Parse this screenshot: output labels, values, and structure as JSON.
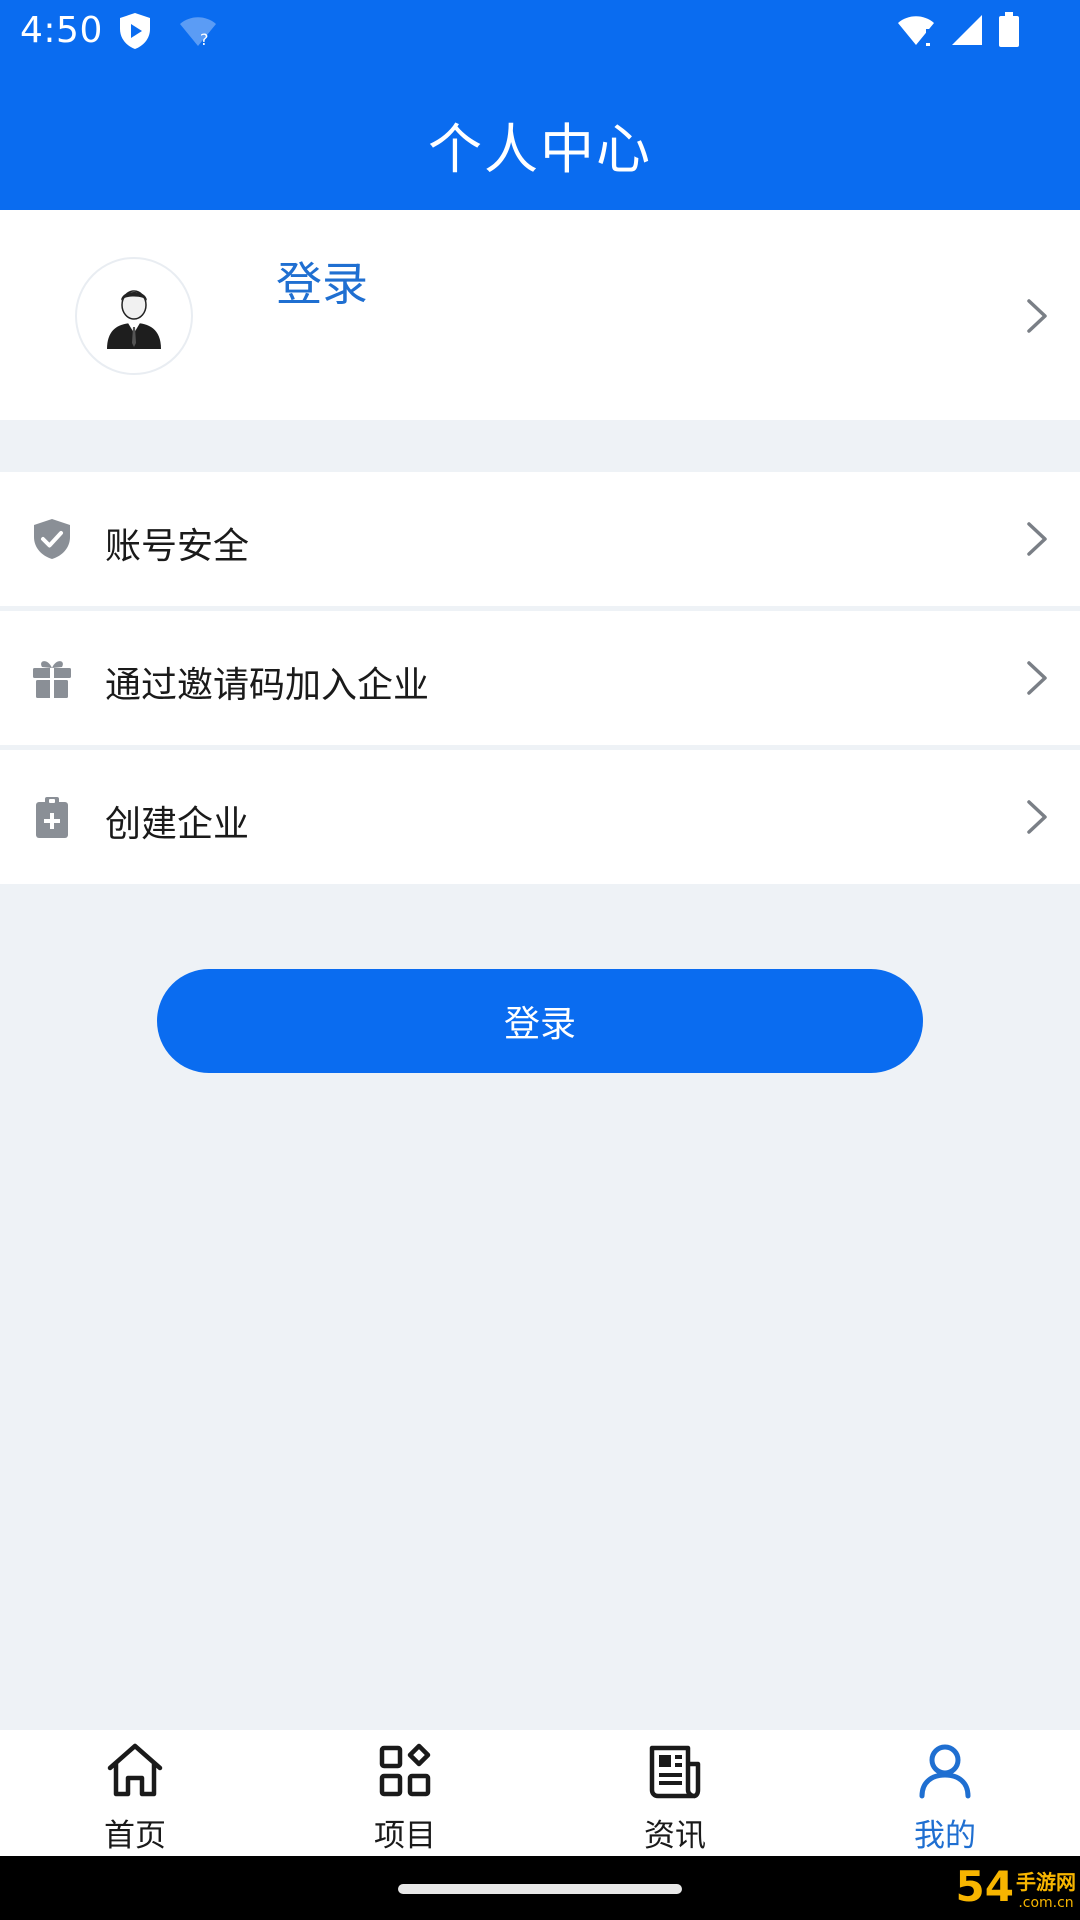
{
  "status_bar": {
    "time": "4:50",
    "left_icons": [
      "shield-play-icon",
      "wifi-question-icon"
    ],
    "right_icons": [
      "wifi-icon",
      "signal-icon",
      "battery-icon"
    ]
  },
  "header": {
    "title": "个人中心"
  },
  "profile": {
    "login_text": "登录",
    "avatar_icon": "user-avatar-icon"
  },
  "menu": {
    "items": [
      {
        "label": "账号安全",
        "icon": "shield-check-icon"
      },
      {
        "label": "通过邀请码加入企业",
        "icon": "gift-icon"
      },
      {
        "label": "创建企业",
        "icon": "clipboard-plus-icon"
      }
    ]
  },
  "login_button": {
    "label": "登录"
  },
  "bottom_nav": {
    "items": [
      {
        "label": "首页",
        "icon": "home-icon",
        "active": false
      },
      {
        "label": "项目",
        "icon": "grid-icon",
        "active": false
      },
      {
        "label": "资讯",
        "icon": "newspaper-icon",
        "active": false
      },
      {
        "label": "我的",
        "icon": "person-icon",
        "active": true
      }
    ]
  },
  "watermark": {
    "number": "54",
    "cn": "手游网",
    "en": ".com.cn"
  },
  "colors": {
    "primary": "#0a6cf0",
    "link": "#1f6fd1",
    "background": "#eef2f6",
    "icon_gray": "#8a8f96"
  }
}
